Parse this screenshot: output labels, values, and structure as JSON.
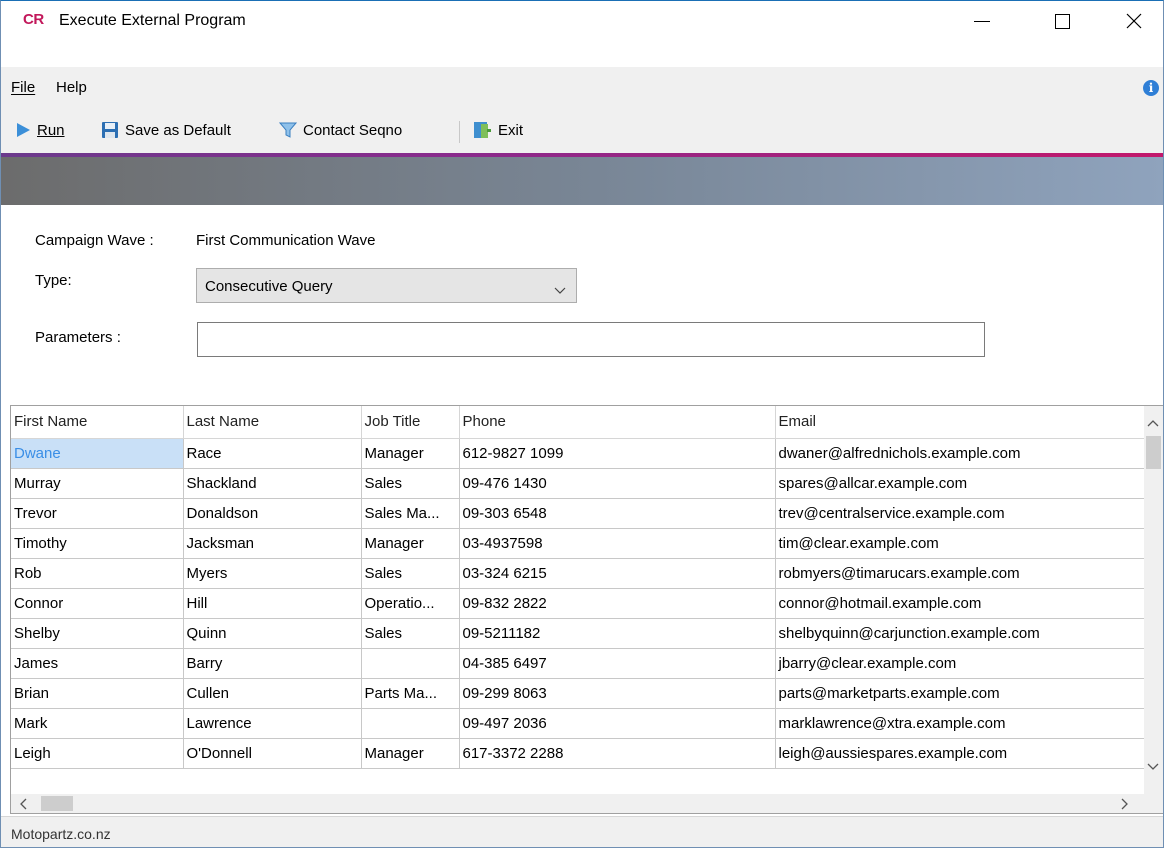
{
  "window": {
    "logo": "CR",
    "title": "Execute External Program",
    "accent_color": "#c2185b"
  },
  "menu": {
    "file": "File",
    "help": "Help",
    "info_icon": "i"
  },
  "toolbar": {
    "run": "Run",
    "save_default": "Save as Default",
    "contact_seqno": "Contact Seqno",
    "exit": "Exit"
  },
  "form": {
    "campaign_label": "Campaign Wave :",
    "campaign_value": "First Communication Wave",
    "type_label": "Type:",
    "type_value": "Consecutive Query",
    "params_label": "Parameters :",
    "params_value": ""
  },
  "grid": {
    "columns": [
      "First Name",
      "Last Name",
      "Job Title",
      "Phone",
      "Email"
    ],
    "rows": [
      [
        "Dwane",
        "Race",
        "Manager",
        "612-9827 1099",
        "dwaner@alfrednichols.example.com"
      ],
      [
        "Murray",
        "Shackland",
        "Sales",
        "09-476 1430",
        "spares@allcar.example.com"
      ],
      [
        "Trevor",
        "Donaldson",
        "Sales Ma...",
        "09-303 6548",
        "trev@centralservice.example.com"
      ],
      [
        "Timothy",
        "Jacksman",
        "Manager",
        "03-4937598",
        "tim@clear.example.com"
      ],
      [
        "Rob",
        "Myers",
        "Sales",
        "03-324 6215",
        "robmyers@timarucars.example.com"
      ],
      [
        "Connor",
        "Hill",
        "Operatio...",
        "09-832 2822",
        "connor@hotmail.example.com"
      ],
      [
        "Shelby",
        "Quinn",
        "Sales",
        "09-5211182",
        "shelbyquinn@carjunction.example.com"
      ],
      [
        "James",
        "Barry",
        "",
        "04-385 6497",
        "jbarry@clear.example.com"
      ],
      [
        "Brian",
        "Cullen",
        "Parts Ma...",
        "09-299 8063",
        "parts@marketparts.example.com"
      ],
      [
        "Mark",
        "Lawrence",
        "",
        "09-497 2036",
        "marklawrence@xtra.example.com"
      ],
      [
        "Leigh",
        "O'Donnell",
        "Manager",
        "617-3372 2288",
        "leigh@aussiespares.example.com"
      ]
    ]
  },
  "status": {
    "text": "Motopartz.co.nz"
  }
}
